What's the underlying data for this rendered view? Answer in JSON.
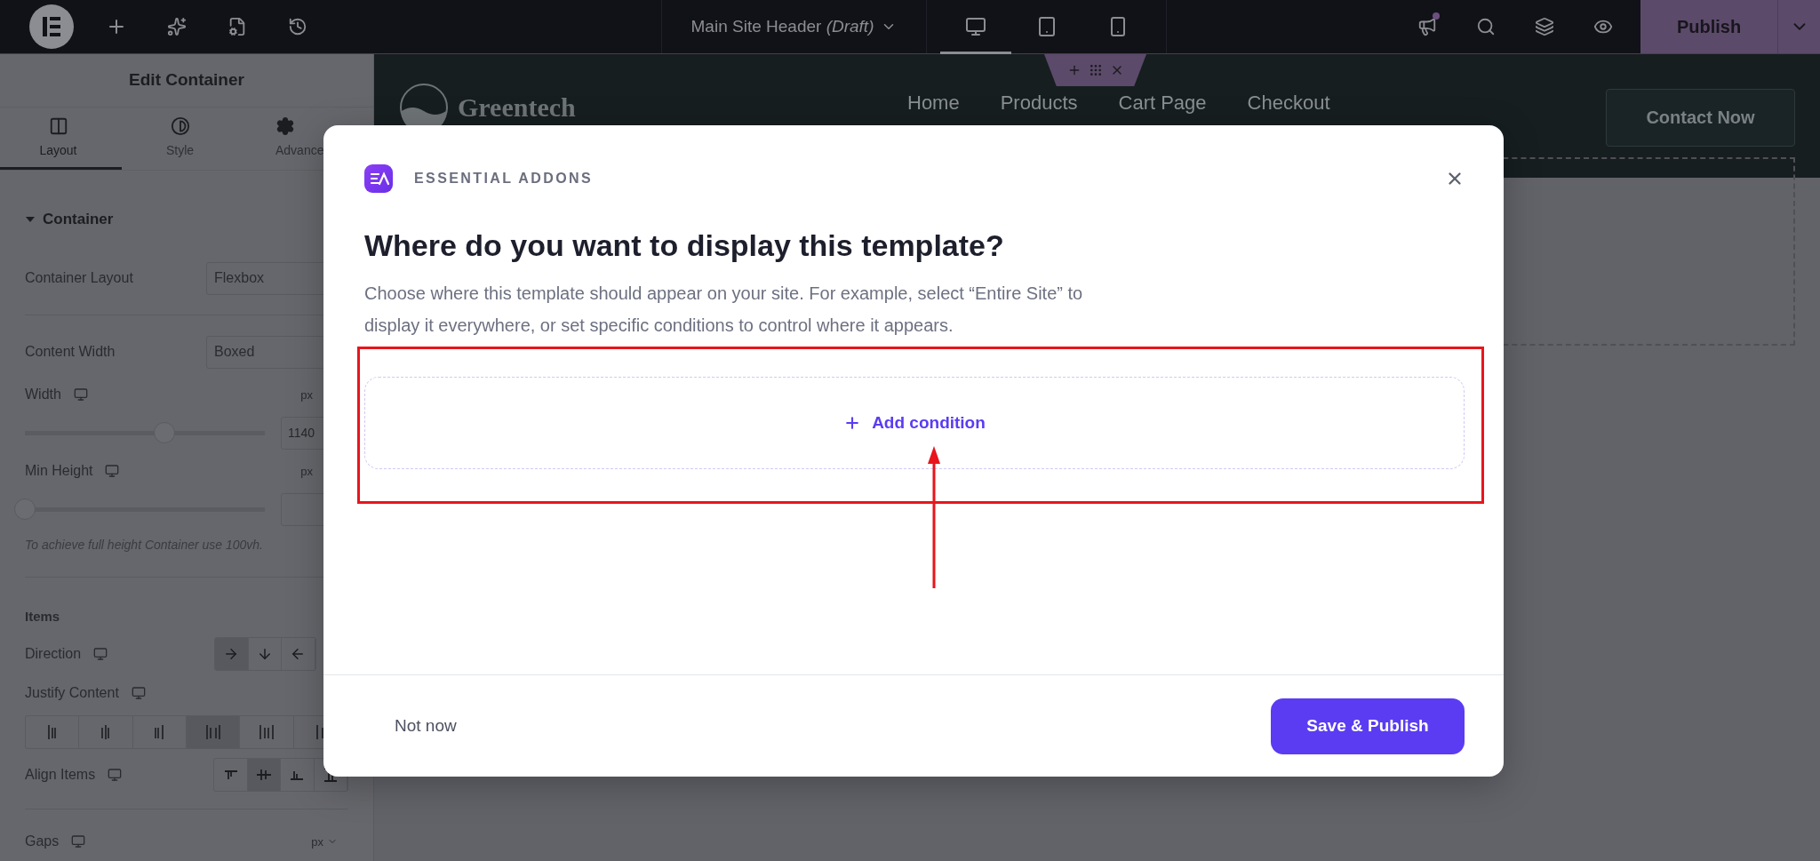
{
  "top_bar": {
    "title": "Main Site Header",
    "status": "(Draft)",
    "devices": [
      {
        "kind": "desktop",
        "selected": true
      },
      {
        "kind": "tablet",
        "selected": false
      },
      {
        "kind": "mobile",
        "selected": false
      }
    ],
    "has_notification": true,
    "publish": "Publish"
  },
  "panel": {
    "title": "Edit Container",
    "tabs": [
      {
        "kind": "layout",
        "label": "Layout",
        "selected": true
      },
      {
        "kind": "style",
        "label": "Style",
        "selected": false
      },
      {
        "kind": "advanced",
        "label": "Advance",
        "selected": false
      }
    ],
    "section": {
      "title": "Container",
      "expanded": true
    },
    "controls": [
      {
        "kind": "select",
        "label": "Container Layout",
        "value": "Flexbox"
      },
      {
        "kind": "divider"
      },
      {
        "kind": "select",
        "label": "Content Width",
        "value": "Boxed"
      },
      {
        "kind": "slider",
        "label": "Width",
        "unit": "px",
        "value": "1140",
        "level": 0.58
      },
      {
        "kind": "slider",
        "label": "Min Height",
        "unit": "px",
        "level": 0
      },
      {
        "kind": "note",
        "text": "To achieve full height Container use 100vh."
      },
      {
        "kind": "divider"
      },
      {
        "kind": "heading",
        "text": "Items"
      },
      {
        "kind": "choices",
        "label": "Direction",
        "options": [
          {
            "kind": "right",
            "selected": true
          },
          {
            "kind": "down",
            "selected": false
          },
          {
            "kind": "left",
            "selected": false
          }
        ]
      },
      {
        "kind": "wide_choices",
        "label": "Justify Content",
        "options": [
          {
            "kind": "start",
            "selected": false
          },
          {
            "kind": "center",
            "selected": false
          },
          {
            "kind": "end",
            "selected": false
          },
          {
            "kind": "between",
            "selected": true
          },
          {
            "kind": "around",
            "selected": false
          },
          {
            "kind": "evenly",
            "selected": false
          }
        ]
      },
      {
        "kind": "choices",
        "label": "Align Items",
        "options": [
          {
            "kind": "top",
            "selected": false
          },
          {
            "kind": "middle",
            "selected": true
          },
          {
            "kind": "bottom",
            "selected": false
          },
          {
            "kind": "stretch",
            "selected": false
          }
        ]
      },
      {
        "kind": "divider"
      },
      {
        "kind": "unit",
        "label": "Gaps",
        "unit": "px"
      }
    ]
  },
  "canvas": {
    "logo": "Greentech",
    "nav": [
      "Home",
      "Products",
      "Cart Page",
      "Checkout"
    ],
    "cta": "Contact Now"
  },
  "modal": {
    "brand": "ESSENTIAL ADDONS",
    "title": "Where do you want to display this template?",
    "description": "Choose where this template should appear on your site. For example, select “Entire Site” to display it everywhere, or set specific conditions to control where it appears.",
    "add_condition": "Add condition",
    "secondary": "Not now",
    "primary": "Save & Publish"
  }
}
